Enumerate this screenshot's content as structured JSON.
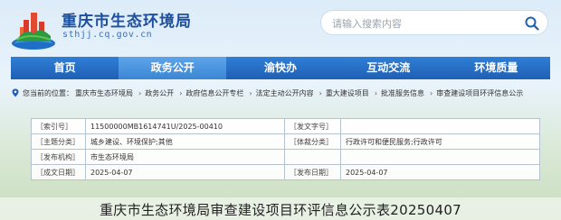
{
  "header": {
    "site_title": "重庆市生态环境局",
    "site_url": "sthjj.cq.gov.cn"
  },
  "search": {
    "placeholder": "请输入搜索内容"
  },
  "nav": {
    "items": [
      "首页",
      "政务公开",
      "渝快办",
      "互动交流",
      "环境质量"
    ],
    "active_index": 1
  },
  "breadcrumb": {
    "prefix": "您当前的位置：",
    "items": [
      "重庆市生态环境局",
      "政务公开",
      "政府信息公开专栏",
      "法定主动公开内容",
      "重大建设项目",
      "批准服务信息",
      "审查建设项目环评信息公示"
    ]
  },
  "info": {
    "rows": [
      {
        "k1": "［索引号］",
        "v1": "11500000MB1614741U/2025-00410",
        "k2": "［发文字号］",
        "v2": ""
      },
      {
        "k1": "［主题分类］",
        "v1": "城乡建设、环境保护;其他",
        "k2": "［体裁分类］",
        "v2": "行政许可和便民服务;行政许可"
      },
      {
        "k1": "［发布机构］",
        "v1": "市生态环境局",
        "k2": "",
        "v2": ""
      },
      {
        "k1": "［成文日期］",
        "v1": "2025-04-07",
        "k2": "［发布日期］",
        "v2": "2025-04-07"
      }
    ]
  },
  "page": {
    "title": "重庆市生态环境局审查建设项目环评信息公示表20250407"
  },
  "colors": {
    "brand_blue": "#1c4fa0",
    "nav_blue": "#1f5fb5",
    "nav_active": "#4a95e0"
  }
}
